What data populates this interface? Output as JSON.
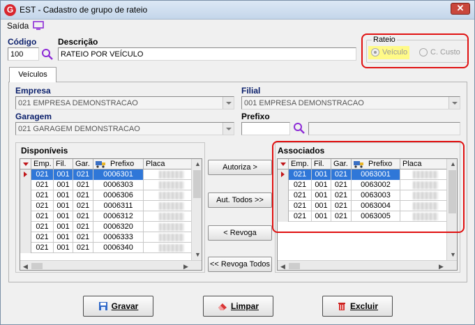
{
  "window": {
    "title": "EST - Cadastro de grupo de rateio",
    "close": "✕"
  },
  "app_icon": "G",
  "menu": {
    "saida": "Saída"
  },
  "form": {
    "codigo_label": "Código",
    "codigo_value": "100",
    "descricao_label": "Descrição",
    "descricao_value": "RATEIO POR VEÍCULO"
  },
  "rateio": {
    "title": "Rateio",
    "options": [
      {
        "label": "Veículo",
        "checked": true
      },
      {
        "label": "C. Custo",
        "checked": false
      }
    ]
  },
  "tabs": [
    {
      "label": "Veículos"
    }
  ],
  "filters": {
    "empresa_label": "Empresa",
    "empresa_value": "021 EMPRESA DEMONSTRACAO",
    "filial_label": "Filial",
    "filial_value": "001 EMPRESA DEMONSTRACAO",
    "garagem_label": "Garagem",
    "garagem_value": "021 GARAGEM DEMONSTRACAO",
    "prefixo_label": "Prefixo",
    "prefixo_value": "",
    "prefixo_desc": ""
  },
  "disponiveis": {
    "title": "Disponíveis",
    "columns": [
      "Emp.",
      "Fil.",
      "Gar.",
      "Prefixo",
      "Placa"
    ],
    "rows": [
      [
        "021",
        "001",
        "021",
        "0006301"
      ],
      [
        "021",
        "001",
        "021",
        "0006303"
      ],
      [
        "021",
        "001",
        "021",
        "0006306"
      ],
      [
        "021",
        "001",
        "021",
        "0006311"
      ],
      [
        "021",
        "001",
        "021",
        "0006312"
      ],
      [
        "021",
        "001",
        "021",
        "0006320"
      ],
      [
        "021",
        "001",
        "021",
        "0006333"
      ],
      [
        "021",
        "001",
        "021",
        "0006340"
      ]
    ]
  },
  "associados": {
    "title": "Associados",
    "columns": [
      "Emp.",
      "Fil.",
      "Gar.",
      "Prefixo",
      "Placa"
    ],
    "rows": [
      [
        "021",
        "001",
        "021",
        "0063001"
      ],
      [
        "021",
        "001",
        "021",
        "0063002"
      ],
      [
        "021",
        "001",
        "021",
        "0063003"
      ],
      [
        "021",
        "001",
        "021",
        "0063004"
      ],
      [
        "021",
        "001",
        "021",
        "0063005"
      ]
    ]
  },
  "transfer_buttons": {
    "autoriza": "Autoriza >",
    "aut_todos": "Aut. Todos >>",
    "revoga": "< Revoga",
    "revoga_todos": "<< Revoga Todos"
  },
  "actions": {
    "gravar": "Gravar",
    "limpar": "Limpar",
    "excluir": "Excluir"
  },
  "colors": {
    "selection": "#2f77d8",
    "highlight": "#e01010",
    "accent_label": "#0a1f6b"
  }
}
